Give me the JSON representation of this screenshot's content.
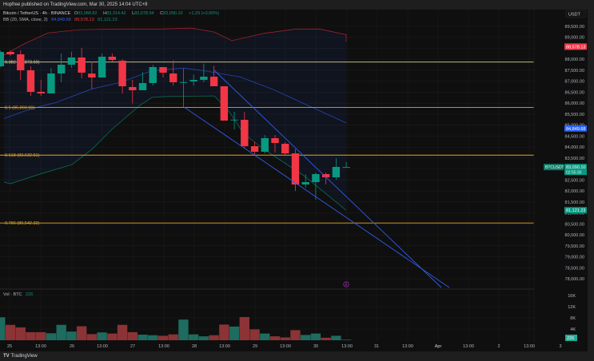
{
  "header": {
    "published": "Hopfree published on TradingView.com, Mar 30, 2025 14:04 UTC+8"
  },
  "legend": {
    "symbol": "Bitcoin / TetherUS · 4h · BINANCE",
    "o_label": "O",
    "o": "83,088.82",
    "h_label": "H",
    "h": "83,314.42",
    "l_label": "L",
    "l": "83,078.94",
    "c_label": "C",
    "c": "83,090.10",
    "change": "+1.29 (+0.00%)",
    "bb_label": "BB (20, SMA, close, 2)",
    "bb_basis": "84,849.68",
    "bb_upper": "88,578.13",
    "bb_lower": "81,121.23",
    "vol_label": "Vol · BTC",
    "vol_value": "226"
  },
  "colors": {
    "up": "#089981",
    "down": "#f23645",
    "basis": "#2962ff",
    "upper": "#a0202e",
    "lower": "#0b6b52",
    "fib": "#e0a526",
    "fib_top": "#d8cf9a",
    "channel": "#2f5bea",
    "background": "#0f0f0f"
  },
  "price_axis": {
    "currency": "USDT",
    "ticks": [
      "89,500.00",
      "89,000.00",
      "88,500.00",
      "88,000.00",
      "87,500.00",
      "87,000.00",
      "86,500.00",
      "86,000.00",
      "85,500.00",
      "85,000.00",
      "84,500.00",
      "84,000.00",
      "83,500.00",
      "83,000.00",
      "82,500.00",
      "82,000.00",
      "81,500.00",
      "81,000.00",
      "80,500.00",
      "80,000.00",
      "79,500.00",
      "79,000.00",
      "78,500.00",
      "78,000.00"
    ],
    "tick_values": [
      89500,
      89000,
      88500,
      88000,
      87500,
      87000,
      86500,
      86000,
      85500,
      85000,
      84500,
      84000,
      83500,
      83000,
      82500,
      82000,
      81500,
      81000,
      80500,
      80000,
      79500,
      79000,
      78500,
      78000
    ],
    "badges": {
      "upper": {
        "text": "88,578.13",
        "value": 88578.13
      },
      "basis": {
        "text": "84,849.68",
        "value": 84849.68
      },
      "last_symbol": "BTCUSDT",
      "last": {
        "text": "83,090.10",
        "value": 83090.1
      },
      "countdown": "02:55:30",
      "lower": {
        "text": "81,121.23",
        "value": 81121.23
      }
    }
  },
  "volume_axis": {
    "ticks": [
      "16K",
      "12K",
      "8K",
      "4K"
    ],
    "tick_values": [
      16,
      12,
      8,
      4
    ],
    "badge": "226"
  },
  "time_axis": [
    "25",
    "13:00",
    "26",
    "13:00",
    "27",
    "13:00",
    "28",
    "13:00",
    "29",
    "13:00",
    "30",
    "13:00",
    "31",
    "13:00",
    "Apr",
    "13:00",
    "2",
    "13:00",
    "3"
  ],
  "fib_levels": [
    {
      "label": "0.382 (87,873.69)",
      "value": 87873.69
    },
    {
      "label": "0.5 (85,803.00)",
      "value": 85803.0
    },
    {
      "label": "0.618 (83,632.51)",
      "value": 83632.51
    },
    {
      "label": "0.786 (80,542.32)",
      "value": 80542.32
    }
  ],
  "chart_data": {
    "type": "candlestick",
    "candles_ohlc": [
      [
        87680,
        88400,
        87650,
        88335
      ],
      [
        88335,
        88400,
        88150,
        88226
      ],
      [
        88226,
        88408,
        87062,
        87499
      ],
      [
        87499,
        87680,
        86334,
        86516
      ],
      [
        86516,
        87060,
        86330,
        86444
      ],
      [
        86444,
        87610,
        86444,
        87353
      ],
      [
        87353,
        88260,
        86950,
        87753
      ],
      [
        87753,
        88340,
        87610,
        88081
      ],
      [
        88081,
        88520,
        87130,
        87390
      ],
      [
        87350,
        87890,
        86660,
        87170
      ],
      [
        87170,
        88260,
        87170,
        88117
      ],
      [
        88117,
        88260,
        87900,
        87972
      ],
      [
        87935,
        88000,
        86440,
        86771
      ],
      [
        86734,
        87060,
        85990,
        86589
      ],
      [
        86589,
        87420,
        86589,
        86916
      ],
      [
        86916,
        87750,
        86800,
        87644
      ],
      [
        87644,
        87644,
        87170,
        87389
      ],
      [
        87353,
        87950,
        86800,
        86953
      ],
      [
        86950,
        87570,
        85825,
        86960
      ],
      [
        86990,
        87300,
        86800,
        87060
      ],
      [
        87060,
        87800,
        86950,
        87207
      ],
      [
        87207,
        87700,
        86770,
        86771
      ],
      [
        86771,
        86771,
        85206,
        85206
      ],
      [
        85242,
        85606,
        84806,
        85250
      ],
      [
        85242,
        85600,
        83970,
        84041
      ],
      [
        84041,
        84230,
        83600,
        83787
      ],
      [
        83787,
        84550,
        83700,
        84405
      ],
      [
        84405,
        84550,
        83750,
        84187
      ],
      [
        84150,
        84230,
        83640,
        83714
      ],
      [
        83714,
        83900,
        82000,
        82295
      ],
      [
        82295,
        82760,
        82150,
        82404
      ],
      [
        82404,
        82840,
        81600,
        82768
      ],
      [
        82768,
        82840,
        82300,
        82622
      ],
      [
        82622,
        83496,
        82513,
        83095
      ],
      [
        83088.82,
        83314.42,
        83078.94,
        83090.1
      ]
    ],
    "volume_k": [
      8.2,
      5.5,
      4.6,
      2.9,
      2.9,
      2.5,
      5.5,
      3.1,
      5.0,
      2.2,
      2.8,
      2.4,
      5.5,
      2.9,
      2.0,
      1.8,
      1.6,
      2.1,
      7.4,
      2.1,
      1.4,
      1.8,
      5.6,
      4.9,
      8.3,
      3.9,
      2.4,
      1.4,
      1.0,
      3.6,
      1.9,
      2.4,
      0.9,
      1.6,
      0.2
    ],
    "bb_upper": [
      88200,
      88700,
      89200,
      89350,
      89380,
      89380,
      89420,
      89240,
      88850,
      89180,
      89380,
      89380,
      89120,
      88800
    ],
    "bb_basis": [
      85300,
      85630,
      85850,
      86030,
      86650,
      86940,
      87480,
      87600,
      87450,
      87200,
      86650,
      86320,
      85650,
      85100
    ],
    "bb_lower": [
      82400,
      82330,
      82770,
      83200,
      83900,
      84810,
      85900,
      86260,
      86300,
      86330,
      85700,
      84600,
      83900,
      82700,
      81121
    ],
    "ylim": [
      77700,
      89900
    ]
  },
  "footer": {
    "brand": "TradingView"
  }
}
